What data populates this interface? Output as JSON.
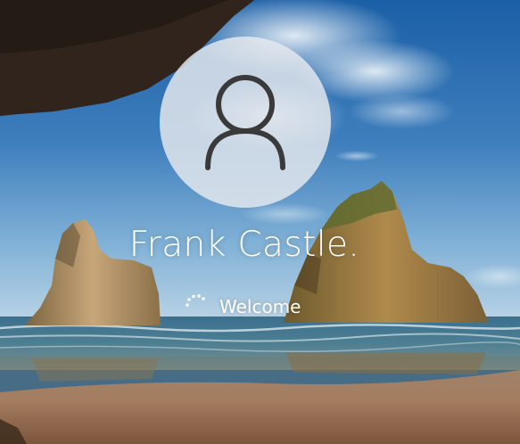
{
  "login": {
    "user_name": "Frank Castle.",
    "status_text": "Welcome"
  },
  "icons": {
    "avatar": "user-silhouette-icon",
    "spinner": "loading-spinner-icon"
  },
  "colors": {
    "text": "#ffffff",
    "avatar_bg": "#e8eaee",
    "avatar_glyph": "#3a3a3a"
  }
}
